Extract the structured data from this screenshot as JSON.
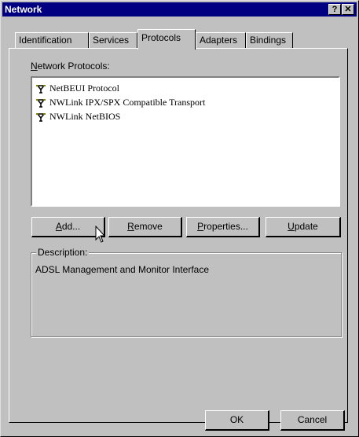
{
  "window": {
    "title": "Network",
    "help_glyph": "?",
    "close_glyph": "✕"
  },
  "tabs": [
    {
      "label": "Identification",
      "active": false
    },
    {
      "label": "Services",
      "active": false
    },
    {
      "label": "Protocols",
      "active": true
    },
    {
      "label": "Adapters",
      "active": false
    },
    {
      "label": "Bindings",
      "active": false
    }
  ],
  "protocols_label": {
    "hotkey": "N",
    "rest": "etwork Protocols:"
  },
  "protocols": [
    {
      "icon": "network-protocol-icon",
      "label": "NetBEUI Protocol"
    },
    {
      "icon": "network-protocol-icon",
      "label": "NWLink IPX/SPX Compatible Transport"
    },
    {
      "icon": "network-protocol-icon",
      "label": "NWLink NetBIOS"
    }
  ],
  "buttons": {
    "add": {
      "hotkey": "A",
      "rest": "dd..."
    },
    "remove": {
      "hotkey": "R",
      "rest": "emove"
    },
    "properties": {
      "hotkey": "P",
      "rest": "roperties..."
    },
    "update": {
      "hotkey": "U",
      "rest": "pdate"
    }
  },
  "description": {
    "title": "Description:",
    "text": "ADSL Management and Monitor Interface"
  },
  "footer": {
    "ok": "OK",
    "cancel": "Cancel"
  },
  "colors": {
    "titlebar": "#000080",
    "face": "#c0c0c0"
  }
}
